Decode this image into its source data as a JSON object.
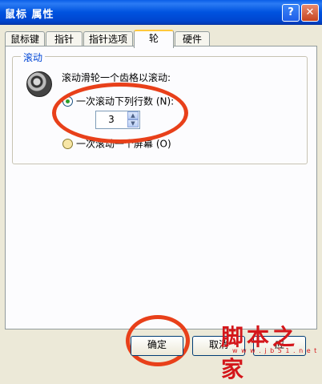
{
  "window": {
    "title": "鼠标 属性",
    "help_glyph": "?",
    "close_glyph": "✕"
  },
  "tabs": [
    {
      "label": "鼠标键"
    },
    {
      "label": "指针"
    },
    {
      "label": "指针选项"
    },
    {
      "label": "轮",
      "active": true
    },
    {
      "label": "硬件"
    }
  ],
  "scroll_group": {
    "label": "滚动",
    "icon": "mouse-wheel-icon",
    "description": "滚动滑轮一个齿格以滚动:",
    "option_lines": {
      "label": "一次滚动下列行数 (N):",
      "selected": true
    },
    "lines_value": "3",
    "option_screen": {
      "label": "一次滚动一个屏幕 (O)",
      "selected": false
    }
  },
  "buttons": {
    "ok": "确定",
    "cancel": "取消",
    "apply_fragment": "应"
  },
  "watermark": {
    "text": "脚本之家",
    "url": "w w w . j b 5 1 . n e t"
  },
  "colors": {
    "annotation_ring": "#e8401a",
    "titlebar": "#0053e0",
    "group_label": "#0046d5",
    "watermark": "#d4161a"
  }
}
